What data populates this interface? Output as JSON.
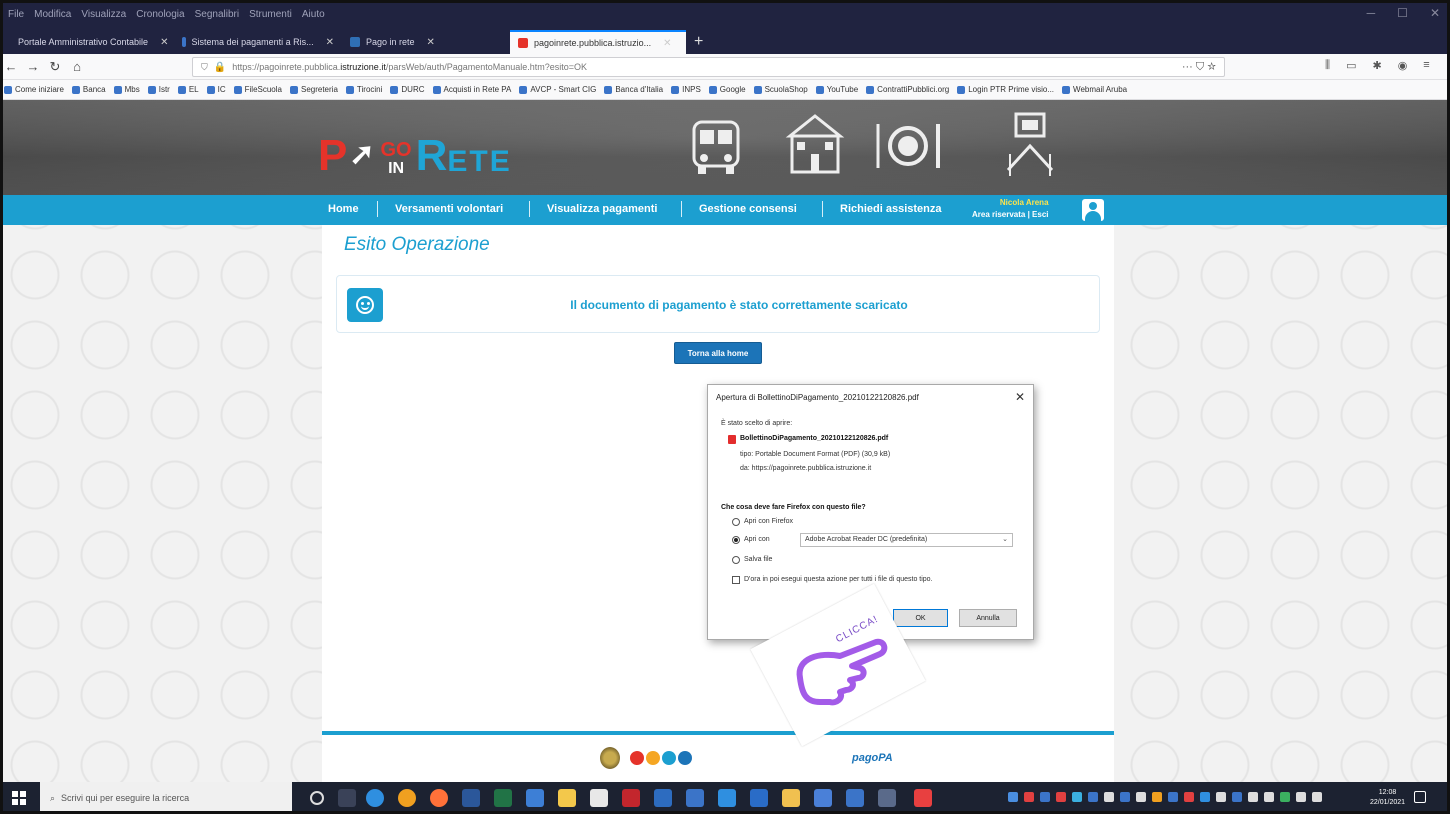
{
  "browser": {
    "menu": [
      "File",
      "Modifica",
      "Visualizza",
      "Cronologia",
      "Segnalibri",
      "Strumenti",
      "Aiuto"
    ],
    "tabs": [
      {
        "label": "Portale Amministrativo Contabile",
        "color": "#3b74c8"
      },
      {
        "label": "Sistema dei pagamenti a Ris...",
        "color": "#3b74c8"
      },
      {
        "label": "Pago in rete",
        "color": "#2f6fb5"
      },
      {
        "label": "pagoinrete.pubblica.istruzio...",
        "color": "#e5332a"
      }
    ],
    "url": {
      "prefix": "https://pagoinrete.pubblica.",
      "domain": "istruzione.it",
      "rest": "/parsWeb/auth/PagamentoManuale.htm?esito=OK"
    },
    "bookmarks": [
      "Come iniziare",
      "Banca",
      "Mbs",
      "Istr",
      "EL",
      "IC",
      "FileScuola",
      "Segreteria",
      "Tirocini",
      "DURC",
      "Acquisti in Rete PA",
      "AVCP - Smart CIG",
      "Banca d'Italia",
      "INPS",
      "Google",
      "ScuolaShop",
      "YouTube",
      "ContrattiPubblici.org",
      "Login PTR Prime visio...",
      "Webmail Aruba"
    ]
  },
  "header": {
    "logo": {
      "p": "P",
      "go": "GO",
      "in": "IN",
      "r": "R",
      "ete": "ETE"
    }
  },
  "nav": {
    "items": [
      "Home",
      "Versamenti volontari",
      "Visualizza pagamenti",
      "Gestione consensi",
      "Richiedi assistenza"
    ],
    "user_name": "Nicola Arena",
    "user_links": "Area riservata | Esci"
  },
  "main": {
    "title": "Esito Operazione",
    "message": "Il documento di pagamento è stato correttamente scaricato",
    "home_button": "Torna alla home"
  },
  "dialog": {
    "title": "Apertura di BollettinoDiPagamento_20210122120826.pdf",
    "intro": "È stato scelto di aprire:",
    "filename": "BollettinoDiPagamento_20210122120826.pdf",
    "type_line": "tipo:  Portable Document Format (PDF) (30,9 kB)",
    "from_line": "da:  https://pagoinrete.pubblica.istruzione.it",
    "question": "Che cosa deve fare Firefox con questo file?",
    "option_open_firefox": "Apri con Firefox",
    "option_open_with": "Apri con",
    "app_selected": "Adobe Acrobat Reader DC (predefinita)",
    "option_save": "Salva file",
    "remember": "D'ora in poi esegui questa azione per tutti i file di questo tipo.",
    "ok": "OK",
    "cancel": "Annulla"
  },
  "overlay": {
    "label": "CLICCA!"
  },
  "taskbar": {
    "search_placeholder": "Scrivi qui per eseguire la ricerca",
    "time": "12:08",
    "date": "22/01/2021"
  }
}
